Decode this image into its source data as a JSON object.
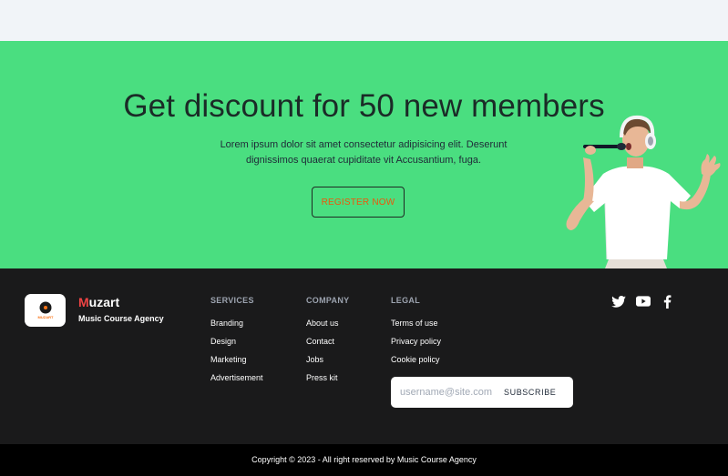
{
  "promo": {
    "title": "Get discount for 50 new members",
    "description": "Lorem ipsum dolor sit amet consectetur adipisicing elit. Deserunt dignissimos quaerat cupiditate vit Accusantium, fuga.",
    "register_label": "REGISTER NOW"
  },
  "brand": {
    "name_first": "M",
    "name_rest": "uzart",
    "tagline": "Music Course Agency",
    "logo_text": "MUZART"
  },
  "footer": {
    "services": {
      "heading": "SERVICES",
      "links": [
        "Branding",
        "Design",
        "Marketing",
        "Advertisement"
      ]
    },
    "company": {
      "heading": "COMPANY",
      "links": [
        "About us",
        "Contact",
        "Jobs",
        "Press kit"
      ]
    },
    "legal": {
      "heading": "LEGAL",
      "links": [
        "Terms of use",
        "Privacy policy",
        "Cookie policy"
      ]
    },
    "subscribe": {
      "placeholder": "username@site.com",
      "button_label": "SUBSCRIBE"
    },
    "social": [
      "twitter-icon",
      "youtube-icon",
      "facebook-icon"
    ]
  },
  "copyright": "Copyright © 2023 - All right reserved by Music Course Agency",
  "colors": {
    "promo_bg": "#4ade80",
    "footer_bg": "#1a1a1b",
    "accent_orange": "#ea580c",
    "brand_red": "#ef4444"
  }
}
